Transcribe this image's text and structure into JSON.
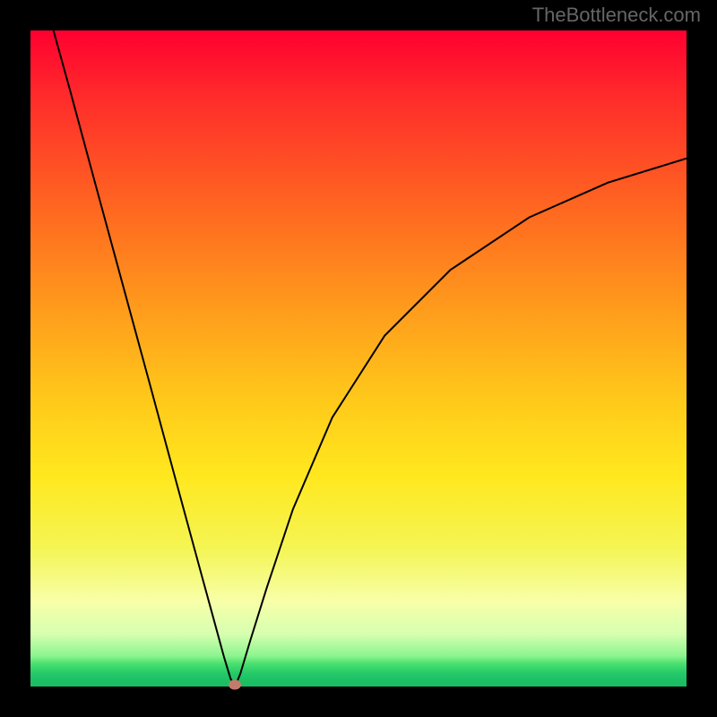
{
  "watermark": "TheBottleneck.com",
  "chart_data": {
    "type": "line",
    "title": "",
    "xlabel": "",
    "ylabel": "",
    "xlim": [
      0,
      100
    ],
    "ylim": [
      0,
      100
    ],
    "grid": false,
    "axes_visible": false,
    "background_gradient": {
      "top": "#ff0030",
      "mid_upper": "#ff9a1c",
      "mid": "#ffe81e",
      "mid_lower": "#f8ffa8",
      "bottom": "#1abc63"
    },
    "series": [
      {
        "name": "bottleneck-curve-left",
        "x": [
          3.5,
          6,
          10,
          14,
          18,
          22,
          26,
          28,
          29.5,
          30.5,
          31.2
        ],
        "y": [
          100,
          91,
          76.2,
          61.5,
          46.8,
          32,
          17.3,
          10,
          4.5,
          1.2,
          0
        ],
        "color": "#000000",
        "width": 2
      },
      {
        "name": "bottleneck-curve-right",
        "x": [
          31.2,
          32,
          33.5,
          36,
          40,
          46,
          54,
          64,
          76,
          88,
          100
        ],
        "y": [
          0,
          2,
          7,
          15,
          27,
          41,
          53.5,
          63.5,
          71.5,
          76.8,
          80.5
        ],
        "color": "#000000",
        "width": 2
      }
    ],
    "marker": {
      "name": "optimal-point",
      "x": 31.2,
      "y": 0.3,
      "color": "#c37b6b"
    }
  }
}
